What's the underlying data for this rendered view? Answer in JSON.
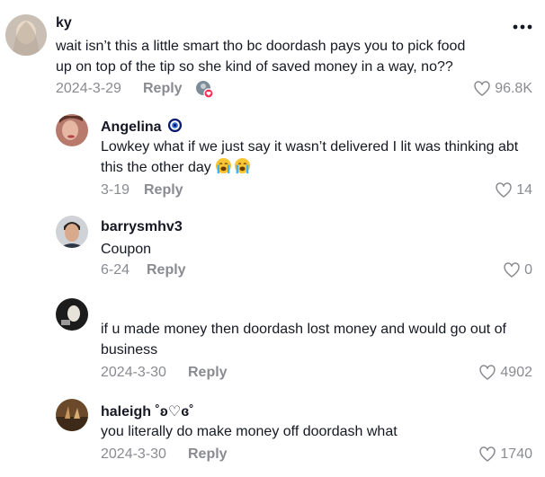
{
  "comments": [
    {
      "username": "ky",
      "text": "wait isn’t this a little smart tho bc doordash pays you to pick food up on top of the tip so she kind of saved money in a way, no??",
      "date": "2024-3-29",
      "reply_label": "Reply",
      "likes": "96.8K",
      "icon": "heart-outline-icon"
    },
    {
      "username": "Angelina",
      "text": "Lowkey what if we just say it wasn’t delivered I lit was thinking abt this the other day",
      "emojis": [
        "loudly-crying-face",
        "loudly-crying-face"
      ],
      "date": "3-19",
      "reply_label": "Reply",
      "likes": "14"
    },
    {
      "username": "barrysmhv3",
      "text": "Coupon",
      "date": "6-24",
      "reply_label": "Reply",
      "likes": "0"
    },
    {
      "username": "",
      "text": "if u made money then doordash lost money and would go out of business",
      "date": "2024-3-30",
      "reply_label": "Reply",
      "likes": "4902"
    },
    {
      "username": "haleigh ˚ʚ♡ɞ˚",
      "text": "you literally do make money off doordash what",
      "date": "2024-3-30",
      "reply_label": "Reply",
      "likes": "1740"
    }
  ],
  "colors": {
    "text": "#161823",
    "secondary": "#8a8b91",
    "verified": "#20d5ec",
    "creator_badge": "#fe2c55"
  }
}
